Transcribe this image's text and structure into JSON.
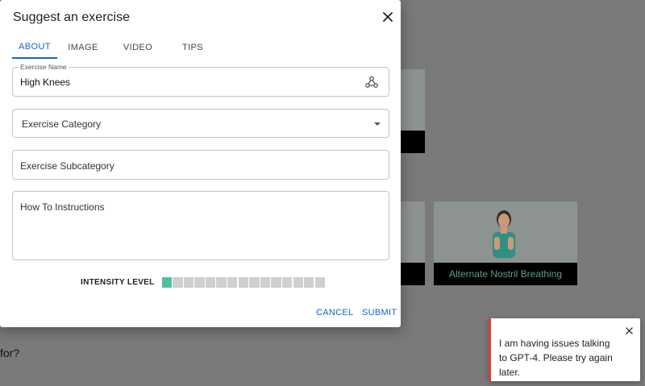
{
  "dialog": {
    "title": "Suggest an exercise",
    "close_icon": "close-icon",
    "tabs": [
      {
        "label": "ABOUT",
        "active": true
      },
      {
        "label": "IMAGE",
        "active": false
      },
      {
        "label": "VIDEO",
        "active": false
      },
      {
        "label": "TIPS",
        "active": false
      }
    ],
    "exercise_name": {
      "label": "Exercise Name",
      "value": "High Knees",
      "icon": "webhook-icon"
    },
    "exercise_category": {
      "placeholder": "Exercise Category",
      "icon": "chevron-down-icon"
    },
    "exercise_subcategory": {
      "placeholder": "Exercise Subcategory"
    },
    "how_to": {
      "placeholder": "How To Instructions"
    },
    "intensity": {
      "label": "INTENSITY LEVEL",
      "value": 1,
      "max": 15
    },
    "actions": {
      "cancel": "CANCEL",
      "submit": "SUBMIT"
    }
  },
  "background": {
    "card_title": "Alternate Nostril Breathing",
    "text_fragment": "for?"
  },
  "toast": {
    "message": "I am having issues talking to GPT-4. Please try again later.",
    "close_icon": "close-icon"
  },
  "colors": {
    "accent": "#1565c0",
    "intensity_on": "#4fc0a0",
    "intensity_off": "#cfcfcf",
    "toast_border": "#e53935"
  }
}
